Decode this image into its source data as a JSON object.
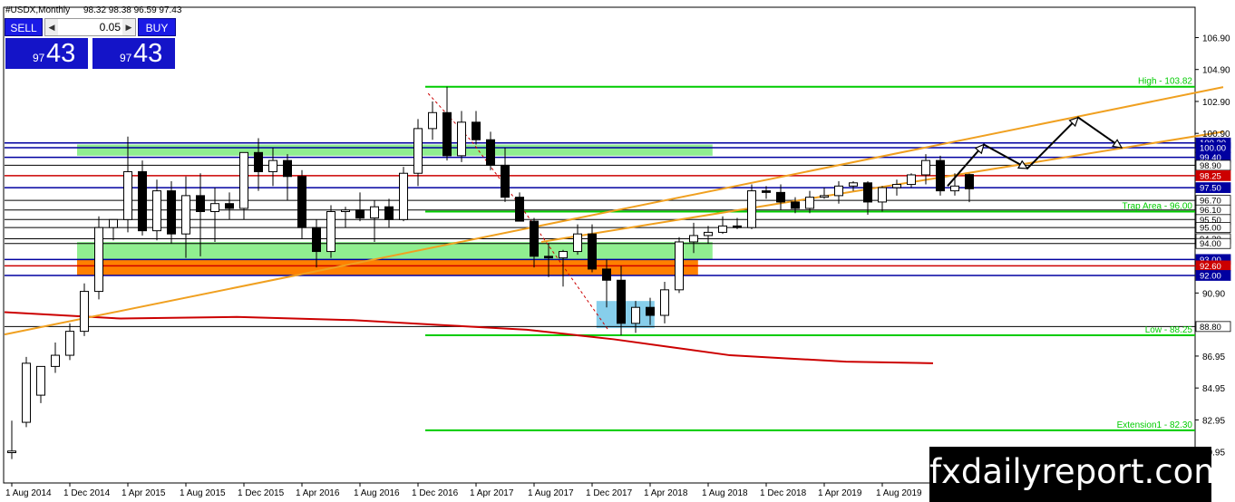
{
  "header": {
    "symbol": "#USDX,Monthly",
    "ohlc": "98.32 98.38 96.59 97.43"
  },
  "ticket": {
    "sell_label": "SELL",
    "buy_label": "BUY",
    "lot": "0.05",
    "bid_small": "97",
    "bid_big": "43",
    "ask_small": "97",
    "ask_big": "43",
    "lot_down_icon": "triangle-left-icon",
    "lot_up_icon": "triangle-right-icon"
  },
  "watermark": "fxdailyreport.com",
  "colors": {
    "bull": "#ffffff",
    "bear": "#000000",
    "green_line": "#00cc00",
    "blue_line": "#0000a0",
    "red_line": "#cc0000",
    "orange_trend": "#f0a020",
    "green_zone": "#90ee90",
    "orange_zone": "#ff8000",
    "blue_zone": "#87ceeb",
    "ma": "#cc0000"
  },
  "chart_data": {
    "type": "candlestick",
    "ylim": [
      79.0,
      108.8
    ],
    "xlim": [
      0,
      64
    ],
    "y_ticks": [
      "106.90",
      "104.90",
      "102.90",
      "100.90",
      "90.90",
      "86.95",
      "84.95",
      "82.95",
      "80.95"
    ],
    "x_ticks": [
      {
        "i": 0,
        "label": "1 Aug 2014"
      },
      {
        "i": 4,
        "label": "1 Dec 2014"
      },
      {
        "i": 8,
        "label": "1 Apr 2015"
      },
      {
        "i": 12,
        "label": "1 Aug 2015"
      },
      {
        "i": 16,
        "label": "1 Dec 2015"
      },
      {
        "i": 20,
        "label": "1 Apr 2016"
      },
      {
        "i": 24,
        "label": "1 Aug 2016"
      },
      {
        "i": 28,
        "label": "1 Dec 2016"
      },
      {
        "i": 32,
        "label": "1 Apr 2017"
      },
      {
        "i": 36,
        "label": "1 Aug 2017"
      },
      {
        "i": 40,
        "label": "1 Dec 2017"
      },
      {
        "i": 44,
        "label": "1 Apr 2018"
      },
      {
        "i": 48,
        "label": "1 Aug 2018"
      },
      {
        "i": 52,
        "label": "1 Dec 2018"
      },
      {
        "i": 56,
        "label": "1 Apr 2019"
      },
      {
        "i": 60,
        "label": "1 Aug 2019"
      }
    ],
    "candles": [
      [
        80.9,
        82.9,
        80.5,
        81.0
      ],
      [
        82.8,
        86.9,
        82.5,
        86.5
      ],
      [
        84.5,
        86.2,
        84.0,
        86.3
      ],
      [
        86.3,
        87.8,
        85.9,
        87.0
      ],
      [
        87.0,
        89.0,
        86.7,
        88.5
      ],
      [
        88.5,
        91.5,
        88.2,
        91.0
      ],
      [
        91.0,
        95.7,
        90.5,
        95.0
      ],
      [
        95.0,
        95.5,
        94.2,
        95.5
      ],
      [
        95.5,
        100.7,
        94.7,
        98.5
      ],
      [
        98.5,
        99.2,
        94.5,
        94.8
      ],
      [
        94.8,
        98.0,
        94.2,
        97.3
      ],
      [
        97.3,
        97.9,
        94.0,
        94.6
      ],
      [
        94.6,
        98.2,
        93.1,
        97.0
      ],
      [
        97.0,
        98.4,
        93.2,
        96.0
      ],
      [
        96.0,
        97.5,
        94.1,
        96.5
      ],
      [
        96.5,
        97.2,
        95.5,
        96.2
      ],
      [
        96.2,
        98.9,
        95.5,
        99.7
      ],
      [
        99.7,
        100.6,
        97.3,
        98.5
      ],
      [
        98.5,
        100.0,
        97.6,
        99.2
      ],
      [
        99.2,
        99.6,
        96.7,
        98.2
      ],
      [
        98.2,
        98.6,
        94.3,
        95.0
      ],
      [
        95.0,
        95.5,
        92.5,
        93.5
      ],
      [
        93.5,
        96.4,
        93.1,
        96.0
      ],
      [
        96.0,
        96.3,
        95.0,
        96.1
      ],
      [
        96.1,
        97.2,
        95.4,
        95.6
      ],
      [
        95.6,
        96.7,
        94.1,
        96.3
      ],
      [
        96.3,
        96.8,
        95.0,
        95.5
      ],
      [
        95.5,
        98.8,
        95.4,
        98.4
      ],
      [
        98.4,
        101.8,
        97.6,
        101.2
      ],
      [
        101.2,
        102.9,
        100.5,
        102.2
      ],
      [
        102.2,
        103.82,
        99.2,
        99.5
      ],
      [
        99.5,
        102.3,
        99.1,
        101.6
      ],
      [
        101.6,
        102.3,
        100.2,
        100.5
      ],
      [
        100.5,
        101.0,
        98.6,
        98.9
      ],
      [
        98.9,
        100.0,
        96.6,
        96.9
      ],
      [
        96.9,
        97.2,
        96.0,
        95.4
      ],
      [
        95.4,
        95.6,
        92.5,
        93.2
      ],
      [
        93.2,
        94.0,
        91.9,
        93.1
      ],
      [
        93.1,
        93.6,
        91.3,
        93.5
      ],
      [
        93.5,
        95.2,
        93.3,
        94.6
      ],
      [
        94.6,
        95.2,
        92.2,
        92.4
      ],
      [
        92.4,
        93.0,
        90.0,
        91.7
      ],
      [
        91.7,
        92.6,
        88.25,
        89.0
      ],
      [
        89.0,
        90.4,
        88.4,
        90.0
      ],
      [
        90.0,
        90.6,
        88.9,
        89.5
      ],
      [
        89.5,
        91.6,
        89.0,
        91.1
      ],
      [
        91.1,
        94.4,
        90.9,
        94.1
      ],
      [
        94.1,
        95.3,
        93.4,
        94.5
      ],
      [
        94.5,
        95.1,
        94.0,
        94.7
      ],
      [
        94.7,
        95.7,
        94.6,
        95.1
      ],
      [
        95.1,
        95.6,
        94.9,
        95.0
      ],
      [
        95.0,
        97.7,
        94.9,
        97.3
      ],
      [
        97.3,
        97.6,
        96.8,
        97.2
      ],
      [
        97.2,
        97.7,
        96.1,
        96.6
      ],
      [
        96.6,
        96.9,
        95.9,
        96.2
      ],
      [
        96.2,
        97.3,
        95.9,
        96.9
      ],
      [
        96.9,
        97.5,
        96.8,
        97.0
      ],
      [
        97.0,
        97.9,
        96.5,
        97.6
      ],
      [
        97.6,
        97.9,
        97.3,
        97.8
      ],
      [
        97.8,
        97.9,
        95.8,
        96.6
      ],
      [
        96.6,
        97.6,
        96.0,
        97.5
      ],
      [
        97.5,
        98.0,
        97.0,
        97.7
      ],
      [
        97.7,
        98.4,
        97.5,
        98.3
      ],
      [
        98.3,
        99.6,
        97.7,
        99.2
      ],
      [
        99.2,
        99.5,
        97.0,
        97.3
      ],
      [
        97.3,
        98.4,
        97.0,
        97.6
      ],
      [
        98.32,
        98.38,
        96.59,
        97.43
      ]
    ],
    "h_levels": [
      {
        "y": 100.3,
        "color": "blue",
        "x_from": 0,
        "label": "100.30"
      },
      {
        "y": 100.0,
        "color": "blue",
        "x_from": 0,
        "label": "100.00"
      },
      {
        "y": 99.4,
        "color": "blue",
        "x_from": 0,
        "label": "99.40"
      },
      {
        "y": 98.9,
        "color": "thin",
        "x_from": 0,
        "label": "98.90"
      },
      {
        "y": 98.25,
        "color": "red",
        "x_from": 0,
        "label": "98.25"
      },
      {
        "y": 97.5,
        "color": "blue",
        "x_from": 0,
        "label": "97.50"
      },
      {
        "y": 96.7,
        "color": "thin",
        "x_from": 0,
        "label": "96.70"
      },
      {
        "y": 96.1,
        "color": "thin",
        "x_from": 0,
        "label": "96.10"
      },
      {
        "y": 95.5,
        "color": "thin",
        "x_from": 0,
        "label": "95.50"
      },
      {
        "y": 95.0,
        "color": "thin",
        "x_from": 0,
        "label": "95.00"
      },
      {
        "y": 94.3,
        "color": "thin",
        "x_from": 0,
        "label": "94.30"
      },
      {
        "y": 94.0,
        "color": "thin",
        "x_from": 0,
        "label": "94.00"
      },
      {
        "y": 93.0,
        "color": "blue",
        "x_from": 0,
        "label": "93.00"
      },
      {
        "y": 92.6,
        "color": "red",
        "x_from": 0,
        "label": "92.60"
      },
      {
        "y": 92.0,
        "color": "blue",
        "x_from": 0,
        "label": "92.00"
      },
      {
        "y": 88.8,
        "color": "thin",
        "x_from": 0,
        "label": "88.80"
      }
    ],
    "axis_badges": [
      {
        "label": "100.30",
        "bg": "#0000a0"
      },
      {
        "label": "100.00",
        "bg": "#0000a0"
      },
      {
        "label": "99.40",
        "bg": "#0000a0"
      },
      {
        "label": "98.90",
        "bg": "#ffffff"
      },
      {
        "label": "98.25",
        "bg": "#cc0000"
      },
      {
        "label": "97.50",
        "bg": "#0000a0"
      },
      {
        "label": "96.70",
        "bg": "#ffffff"
      },
      {
        "label": "96.10",
        "bg": "#ffffff"
      },
      {
        "label": "95.50",
        "bg": "#ffffff"
      },
      {
        "label": "95.00",
        "bg": "#ffffff"
      },
      {
        "label": "94.30",
        "bg": "#ffffff"
      },
      {
        "label": "94.00",
        "bg": "#ffffff"
      },
      {
        "label": "93.00",
        "bg": "#0000a0"
      },
      {
        "label": "92.60",
        "bg": "#cc0000"
      },
      {
        "label": "92.00",
        "bg": "#0000a0"
      },
      {
        "label": "88.80",
        "bg": "#ffffff"
      }
    ],
    "green_levels": [
      {
        "y": 103.82,
        "label": "High - 103.82"
      },
      {
        "y": 96.0,
        "label": "Trap Area - 96.00"
      },
      {
        "y": 88.25,
        "label": "Low - 88.25"
      },
      {
        "y": 82.3,
        "label": "Extension1 - 82.30"
      }
    ],
    "zones": [
      {
        "x0": 5.0,
        "x1": 48.8,
        "y0": 99.5,
        "y1": 100.2,
        "color": "green_zone"
      },
      {
        "x0": 5.0,
        "x1": 48.8,
        "y0": 93.0,
        "y1": 94.1,
        "color": "green_zone"
      },
      {
        "x0": 5.0,
        "x1": 47.8,
        "y0": 92.0,
        "y1": 93.0,
        "color": "orange_zone"
      },
      {
        "x0": 40.8,
        "x1": 44.8,
        "y0": 88.7,
        "y1": 90.4,
        "color": "blue_zone"
      }
    ],
    "trendlines": [
      {
        "x0": 0,
        "y0": 88.3,
        "x1": 84,
        "y1": 103.8
      },
      {
        "x0": 37,
        "y0": 94.1,
        "x1": 84,
        "y1": 101.0
      }
    ],
    "moving_average": [
      [
        0,
        89.7
      ],
      [
        8,
        89.3
      ],
      [
        16,
        89.4
      ],
      [
        24,
        89.2
      ],
      [
        30,
        88.9
      ],
      [
        36,
        88.6
      ],
      [
        42,
        88.0
      ],
      [
        46,
        87.5
      ],
      [
        50,
        87.0
      ],
      [
        54,
        86.8
      ],
      [
        58,
        86.6
      ],
      [
        64,
        86.5
      ]
    ],
    "projection_arrow": [
      [
        65,
        97.6
      ],
      [
        67.5,
        100.2
      ],
      [
        70.5,
        98.7
      ],
      [
        74,
        101.9
      ],
      [
        77,
        100.0
      ]
    ],
    "dashed_path": [
      [
        29.2,
        103.4
      ],
      [
        32.2,
        100.4
      ],
      [
        36.0,
        95.8
      ],
      [
        41.6,
        88.6
      ]
    ]
  }
}
